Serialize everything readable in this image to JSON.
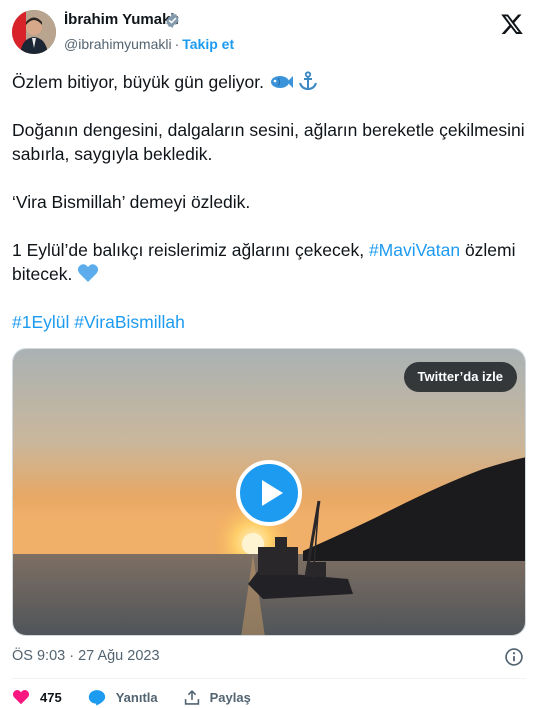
{
  "author": {
    "name": "İbrahim Yumaklı",
    "handle": "@ibrahimyumakli",
    "separator": "·",
    "follow_label": "Takip et",
    "verified_icon": "verified-badge-icon"
  },
  "platform_logo": "x-logo-icon",
  "tweet": {
    "line1": "Özlem bitiyor, büyük gün geliyor.",
    "line1_emojis": [
      "fish-icon",
      "anchor-icon"
    ],
    "para2": "Doğanın dengesini, dalgaların sesini, ağların bereketle çekilmesini sabırla, saygıyla bekledik.",
    "para3": "‘Vira Bismillah’ demeyi özledik.",
    "para4_start": "1 Eylül’de balıkçı reislerimiz ağlarını çekecek, ",
    "para4_hashtag": "#MaviVatan",
    "para4_end": " özlemi bitecek.",
    "para4_emoji": "blue-heart-icon",
    "hashtag1": "#1Eylül",
    "hashtag2": "#ViraBismillah"
  },
  "media": {
    "watch_label": "Twitter’da izle",
    "play_icon": "play-icon",
    "scene": "sunset-sea-fishing-boat"
  },
  "timestamp": "ÖS 9:03 · 27 Ağu 2023",
  "actions": {
    "like_count": "475",
    "reply_label": "Yanıtla",
    "share_label": "Paylaş"
  },
  "colors": {
    "accent": "#1d9bf0",
    "like": "#f91880",
    "text": "#0f1419",
    "muted": "#536471"
  }
}
